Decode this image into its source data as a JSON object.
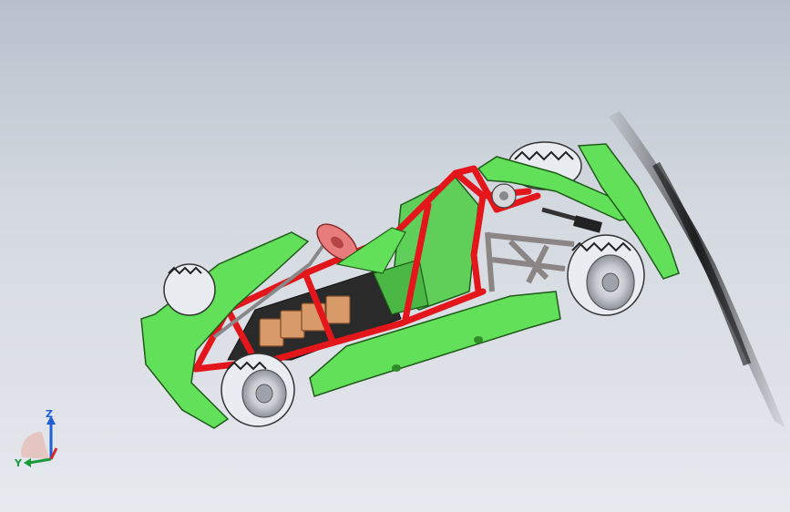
{
  "window": {
    "type": "cad-3d-viewport"
  },
  "model": {
    "colors": {
      "body_panels": "#63e05a",
      "body_panels_edge": "#1f5a1a",
      "frame_tubes": "#e3161c",
      "seat": "#5fcf59",
      "floor_pan": "#2a2a2a",
      "battery_boxes": "#d99a6a",
      "steering_wheel": "#e87c7c",
      "tire": "#e9edf2",
      "tire_tread": "#222222",
      "rim": "#c7cad0",
      "rear_subframe": "#b5aeae",
      "propeller_blade": "#222222"
    }
  },
  "triad": {
    "z_label": "Z",
    "y_label": "Y",
    "x_label": "",
    "colors": {
      "z": "#1f5fd6",
      "y": "#1a9a3a",
      "x": "#d22a2a"
    }
  }
}
